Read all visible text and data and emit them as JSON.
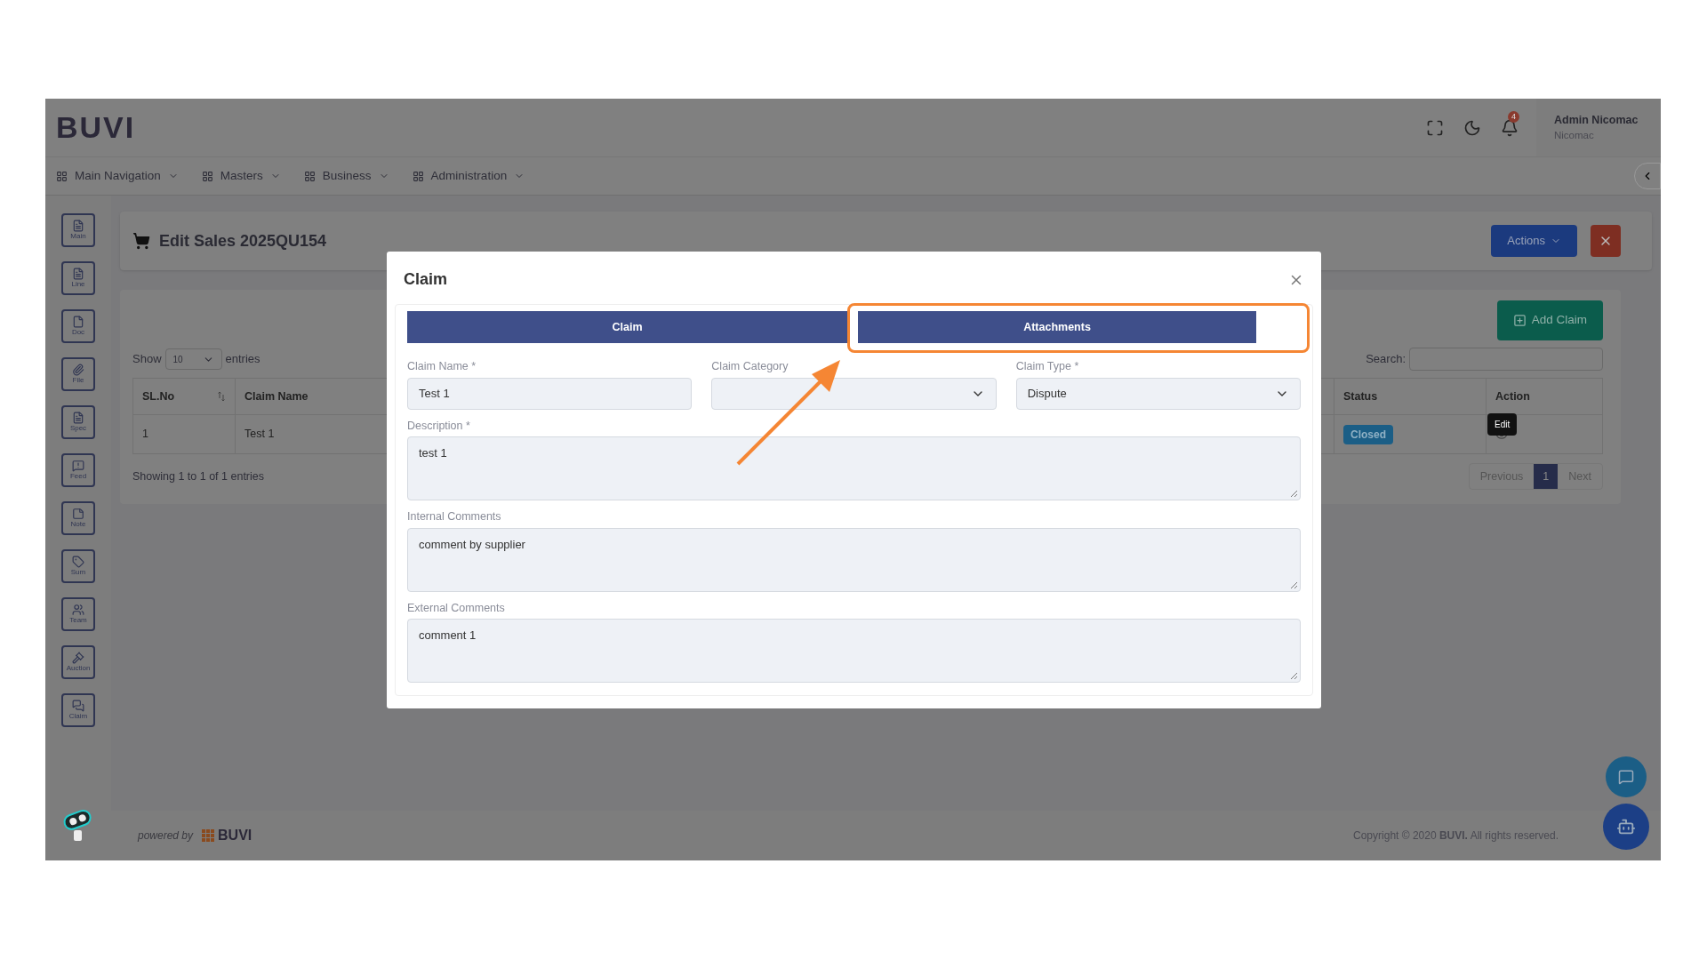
{
  "header": {
    "logo": "BUVI",
    "notification_count": "4",
    "user_name": "Admin Nicomac",
    "user_org": "Nicomac"
  },
  "nav_menu": [
    {
      "label": "Main Navigation"
    },
    {
      "label": "Masters"
    },
    {
      "label": "Business"
    },
    {
      "label": "Administration"
    }
  ],
  "sidebar": {
    "items": [
      {
        "label": "Main"
      },
      {
        "label": "Line"
      },
      {
        "label": "Doc"
      },
      {
        "label": "File"
      },
      {
        "label": "Spec"
      },
      {
        "label": "Feed"
      },
      {
        "label": "Note"
      },
      {
        "label": "Sum"
      },
      {
        "label": "Team"
      },
      {
        "label": "Auction"
      },
      {
        "label": "Claim"
      }
    ]
  },
  "page": {
    "title": "Edit Sales 2025QU154",
    "actions_button": "Actions"
  },
  "table_panel": {
    "add_button": "Add Claim",
    "show_label": "Show",
    "page_size": "10",
    "entries_label": "entries",
    "search_label": "Search:",
    "columns": [
      "SL.No",
      "Claim Name",
      "Status",
      "Action"
    ],
    "rows": [
      {
        "cells": [
          "1",
          "Test 1"
        ],
        "status": "Closed"
      }
    ],
    "tooltip": "Edit",
    "summary": "Showing 1 to 1 of 1 entries",
    "pagination": {
      "previous": "Previous",
      "pages": [
        {
          "label": "1",
          "selected": true
        }
      ],
      "next": "Next"
    }
  },
  "modal": {
    "title": "Claim",
    "tabs": [
      {
        "label": "Claim"
      },
      {
        "label": "Attachments"
      }
    ],
    "fields": [
      {
        "kind": "text",
        "label": "Claim Name *",
        "value": "Test 1"
      },
      {
        "kind": "select",
        "label": "Claim Category"
      },
      {
        "kind": "select",
        "label": "Claim Type *",
        "value": "Dispute"
      },
      {
        "kind": "textarea",
        "label": "Description *",
        "value": "test 1"
      },
      {
        "kind": "textarea",
        "label": "Internal Comments",
        "value": "comment by supplier"
      },
      {
        "kind": "textarea",
        "label": "External Comments",
        "value": "comment 1"
      }
    ]
  },
  "footer": {
    "powered_by": "powered by",
    "brand": "BUVI",
    "copyright": "Copyright © 2020 **BUVI.** All rights reserved."
  }
}
